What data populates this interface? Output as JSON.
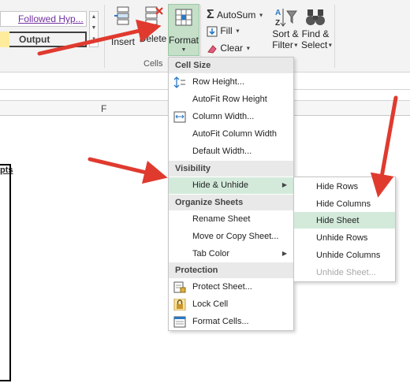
{
  "ribbon": {
    "styles": {
      "followed_link": "Followed Hyp...",
      "output": "Output"
    },
    "cells": {
      "insert_label": "Insert",
      "delete_label": "Delete",
      "format_label": "Format",
      "group_label": "Cells"
    },
    "editing": {
      "autosum_label": "AutoSum",
      "fill_label": "Fill",
      "clear_label": "Clear",
      "sort_label_1": "Sort &",
      "sort_label_2": "Filter",
      "find_label_1": "Find &",
      "find_label_2": "Select"
    }
  },
  "sheet": {
    "column_label": "F",
    "cell_fragment": "pts"
  },
  "format_menu": {
    "cell_size": {
      "heading": "Cell Size",
      "items": [
        "Row Height...",
        "AutoFit Row Height",
        "Column Width...",
        "AutoFit Column Width",
        "Default Width..."
      ]
    },
    "visibility": {
      "heading": "Visibility",
      "items": [
        "Hide & Unhide"
      ]
    },
    "organize": {
      "heading": "Organize Sheets",
      "items": [
        "Rename Sheet",
        "Move or Copy Sheet...",
        "Tab Color"
      ]
    },
    "protection": {
      "heading": "Protection",
      "items": [
        "Protect Sheet...",
        "Lock Cell",
        "Format Cells..."
      ]
    }
  },
  "hide_unhide_submenu": {
    "items": [
      "Hide Rows",
      "Hide Columns",
      "Hide Sheet",
      "Unhide Rows",
      "Unhide Columns",
      "Unhide Sheet..."
    ],
    "highlighted": "Hide Sheet",
    "disabled": "Unhide Sheet..."
  },
  "colors": {
    "highlight": "#d3eadb",
    "format_button": "#c5dfc9",
    "arrow_red": "#e03a2f",
    "link_purple": "#7030a0"
  },
  "icons": [
    "insert-cells-icon",
    "delete-cells-icon",
    "format-icon",
    "autosum-icon",
    "fill-icon",
    "clear-icon",
    "sort-filter-icon",
    "binoculars-icon",
    "row-height-icon",
    "column-width-icon",
    "protect-sheet-icon",
    "lock-icon",
    "format-cells-icon"
  ]
}
